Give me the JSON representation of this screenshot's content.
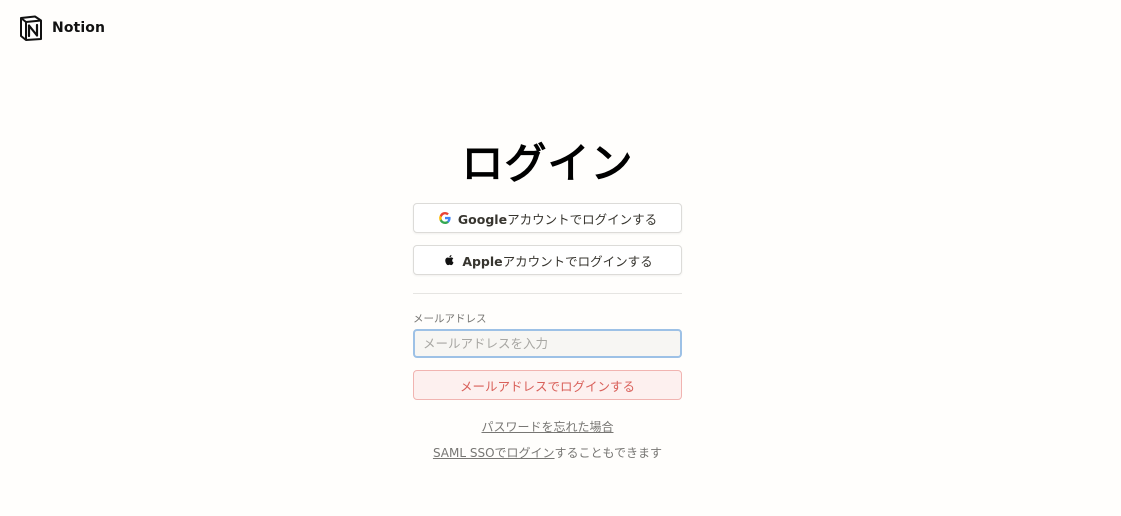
{
  "header": {
    "logo_icon": "notion-logo-icon",
    "brand": "Notion"
  },
  "login": {
    "title": "ログイン",
    "google_button": {
      "icon": "google-icon",
      "brand": "Google",
      "label": "アカウントでログインする"
    },
    "apple_button": {
      "icon": "apple-icon",
      "brand": "Apple",
      "label": "アカウントでログインする"
    },
    "email": {
      "label": "メールアドレス",
      "placeholder": "メールアドレスを入力",
      "value": ""
    },
    "email_login_button": "メールアドレスでログインする",
    "forgot_password_link": "パスワードを忘れた場合",
    "saml_link": "SAML SSOでログイン",
    "saml_suffix": "することもできます"
  },
  "colors": {
    "background": "#fffefc",
    "input_focus_border": "#9dc1e6",
    "email_button_text": "#d9605a",
    "email_button_bg": "#fdf0ef"
  }
}
